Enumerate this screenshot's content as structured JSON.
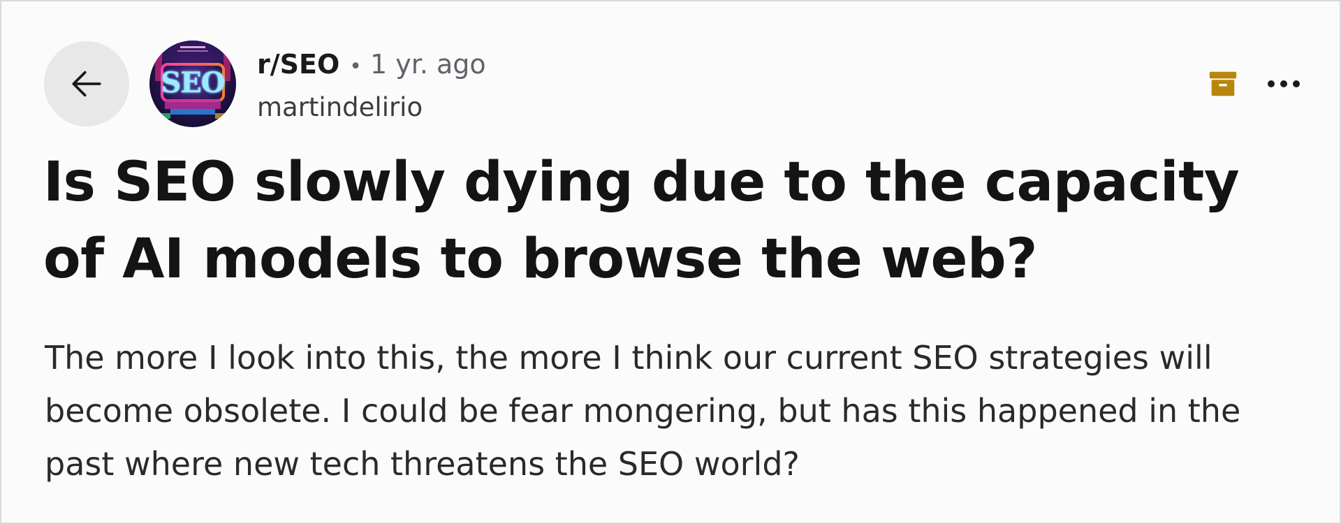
{
  "post": {
    "subreddit": "r/SEO",
    "separator": "•",
    "age": "1 yr. ago",
    "author": "martindelirio",
    "avatar_text": "SEO",
    "title": "Is SEO slowly dying due to the capacity of AI models to browse the web?",
    "body": "The more I look into this, the more I think our current SEO strategies will become obsolete. I could be fear mongering, but has this happened in the past where new tech threatens the SEO world?"
  },
  "icons": {
    "back": "arrow-left-icon",
    "save": "archive-box-icon",
    "more": "more-horizontal-icon"
  },
  "colors": {
    "background": "#fbfbfb",
    "back_button_bg": "#e8e8e8",
    "save_icon": "#b8860b",
    "title_text": "#141414",
    "meta_text": "#5f6368"
  }
}
